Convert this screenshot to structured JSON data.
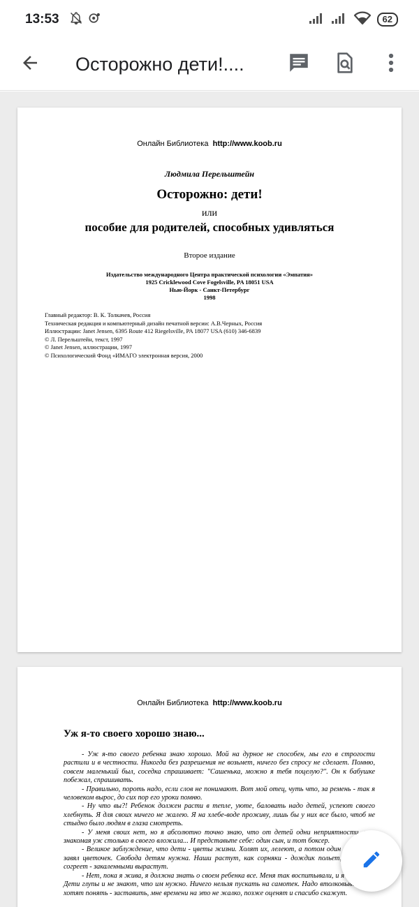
{
  "status_bar": {
    "time": "13:53",
    "battery": "62",
    "icons": [
      "bell-off-icon",
      "notification-app-icon",
      "signal-icon",
      "signal-icon",
      "wifi-icon",
      "battery-icon"
    ]
  },
  "app_bar": {
    "title": "Осторожно дети!....",
    "icons": [
      "back-arrow-icon",
      "comment-icon",
      "document-search-icon",
      "more-vert-icon"
    ]
  },
  "page1": {
    "library_prefix": "Онлайн Библиотека",
    "library_url": "http://www.koob.ru",
    "author": "Людмила Перельштейн",
    "title": "Осторожно: дети!",
    "or": "или",
    "subtitle": "пособие для родителей, способных удивляться",
    "edition": "Второе издание",
    "publisher": [
      "Издательство международного Центра практической психологии «Эмпатия»",
      "1925 Cricklewood Cove Fogelsville, PA 18051 USA",
      "Нью-Йорк - Санкт-Петербург",
      "1998"
    ],
    "credits": [
      "Главный редактор: В. К. Толкачев, Россия",
      "Техническая редакция и компьютерный дизайн печатной версии: А.В.Черных, Россия",
      "Иллюстрации: Janet Jensen, 6395 Route 412 Riegelsville, PA 18077 USA (610) 346-6839",
      "© Л. Перельштейн, текст, 1997",
      "© Janet Jensen, иллюстрации, 1997",
      "© Психологический Фонд «ИМАГО электронная версия, 2000"
    ]
  },
  "page2": {
    "library_prefix": "Онлайн Библиотека",
    "library_url": "http://www.koob.ru",
    "chapter_title": "Уж я-то своего хорошо знаю...",
    "paragraphs": [
      "- Уж я-то своего ребенка знаю хорошо. Мой на дурное не способен, мы его в строгости растили и в честности. Никогда без разрешения не возьмет, ничего без спросу не сделает. Помню, совсем маленький был, соседка спрашивает: \"Сашенька, можно я тебя поцелую?\". Он к бабушке побежал, спрашивать.",
      "- Правильно, пороть надо, если слов не понимают. Вот мой отец, чуть что, за ремень - так я человеком вырос, до сих пор его уроки помню.",
      "- Ну что вы?! Ребенок должен расти в тепле, уюте, баловать надо детей, успеют своего хлебнуть. Я для своих ничего не жалею. Я на хлебе-воде проживу, лишь бы у них все было, чтоб не стыдно было людям в глаза смотреть.",
      "- У меня своих нет, но я абсолютно точно знаю, что от детей одни неприятности, моя знакомая уж столько в своего вложила... И представьте себе: один сын, и тот боксер.",
      "- Великое заблуждение, что дети - цветы жизни. Холят их, лелеют, а потом один сквозняк и завял цветочек. Свобода детям нужна. Наши растут, как сорняки - дождик польет, солнышко согреет - закаленными вырастут.",
      "- Нет, пока я жива, я должна знать о своем ребенка все. Меня так воспитывали, и я так буду. Дети глупы и не знают, что им нужно. Ничего нельзя пускать на самотек. Надо втолковывать, не хотят понять - заставить, мне времени на это не жалко, позже оценят и спасибо скажут."
    ]
  },
  "fab": {
    "icon": "edit-pencil-icon"
  },
  "colors": {
    "accent": "#1a73e8",
    "text": "#202124",
    "viewer_bg": "#ececec"
  }
}
